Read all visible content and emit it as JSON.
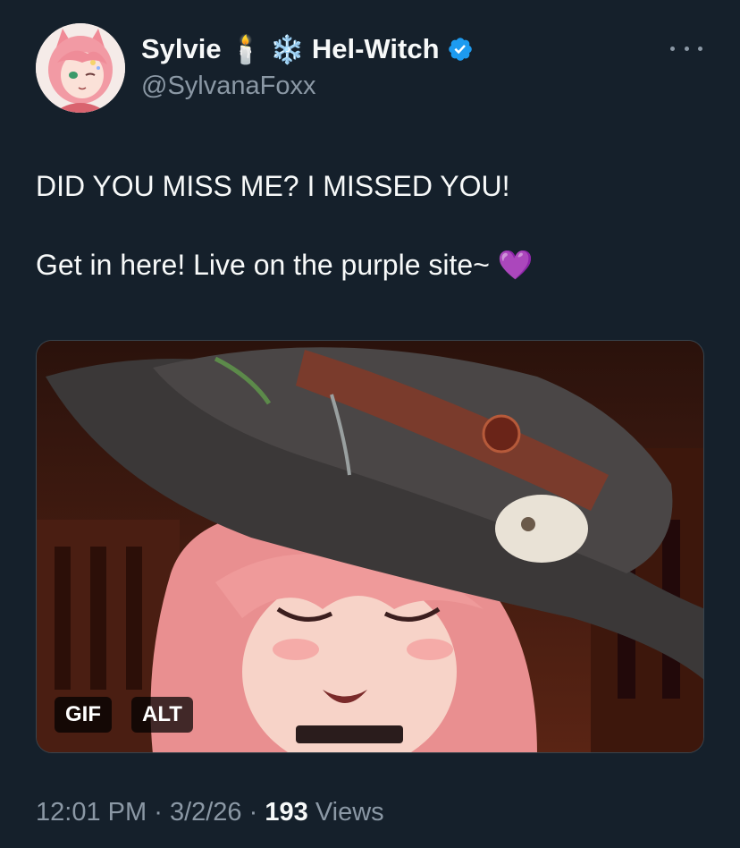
{
  "author": {
    "display_name": "Sylvie",
    "candle_glyph": "🕯️",
    "snowflake_glyph": "❄️",
    "display_name_suffix": "Hel-Witch",
    "handle": "@SylvanaFoxx",
    "verified": true,
    "verified_color": "#1d9bf0"
  },
  "tweet": {
    "line1": "DID YOU MISS ME? I MISSED YOU!",
    "line2": "Get in here! Live on the purple site~ 💜"
  },
  "media": {
    "gif_badge": "GIF",
    "alt_badge": "ALT"
  },
  "meta": {
    "time": "12:01 PM",
    "sep1": "·",
    "date": "3/2/26",
    "sep2": "·",
    "views_count": "193",
    "views_label": "Views"
  },
  "colors": {
    "background": "#15202b",
    "text_primary": "#f7f9f9",
    "text_secondary": "#8b98a5",
    "accent": "#1d9bf0"
  }
}
